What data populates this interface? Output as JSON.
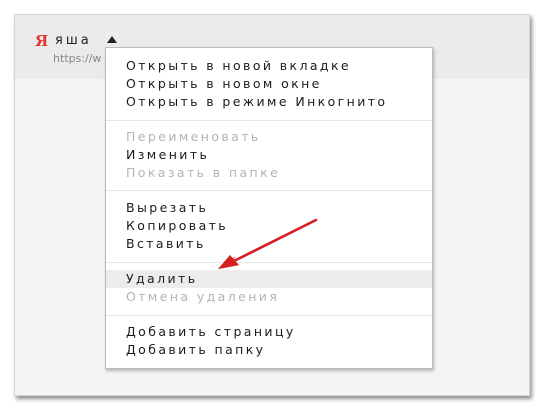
{
  "bookmark": {
    "logo": "Я",
    "title": "яша",
    "url": "https://w"
  },
  "menu": {
    "items": [
      {
        "label": "Открыть в новой вкладке",
        "enabled": true
      },
      {
        "label": "Открыть в новом окне",
        "enabled": true
      },
      {
        "label": "Открыть в режиме Инкогнито",
        "enabled": true
      },
      {
        "label": "Переименовать",
        "enabled": false
      },
      {
        "label": "Изменить",
        "enabled": true
      },
      {
        "label": "Показать в папке",
        "enabled": false
      },
      {
        "label": "Вырезать",
        "enabled": true
      },
      {
        "label": "Копировать",
        "enabled": true
      },
      {
        "label": "Вставить",
        "enabled": true
      },
      {
        "label": "Удалить",
        "enabled": true,
        "highlighted": true
      },
      {
        "label": "Отмена удаления",
        "enabled": false
      },
      {
        "label": "Добавить страницу",
        "enabled": true
      },
      {
        "label": "Добавить папку",
        "enabled": true
      }
    ]
  },
  "colors": {
    "logo": "#e2362a",
    "arrow": "#d42020",
    "disabled_text": "#b4b4b4",
    "highlight": "#ececec"
  },
  "icons": {
    "bookmark_menu_caret": "caret-up-icon",
    "annotation": "red-arrow-icon"
  }
}
